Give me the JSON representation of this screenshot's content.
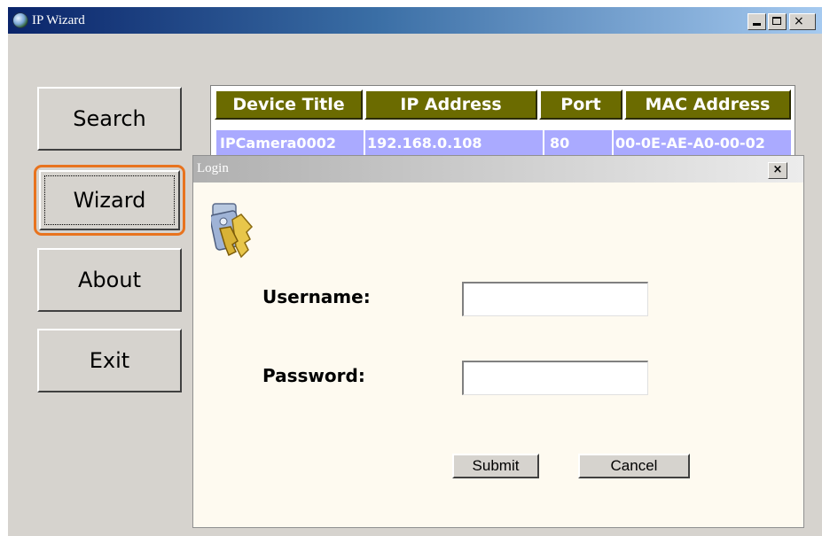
{
  "window": {
    "title": "IP Wizard",
    "icon": "globe-icon",
    "caption_buttons": {
      "minimize": "minimize-icon",
      "maximize": "maximize-icon",
      "close_label": "×"
    }
  },
  "sidebar": {
    "search_label": "Search",
    "wizard_label": "Wizard",
    "about_label": "About",
    "exit_label": "Exit",
    "highlight_color": "#e8731e"
  },
  "device_table": {
    "columns": [
      "Device Title",
      "IP Address",
      "Port",
      "MAC Address"
    ],
    "header_color": "#6b6b00",
    "row_color": "#aaaaff",
    "rows": [
      {
        "device_title": "IPCamera0002",
        "ip_address": "192.168.0.108",
        "port": "80",
        "mac_address": "00-0E-AE-A0-00-02"
      }
    ]
  },
  "login_dialog": {
    "title": "Login",
    "close_label": "×",
    "icon": "keys-icon",
    "username_label": "Username:",
    "username_value": "",
    "password_label": "Password:",
    "password_value": "",
    "submit_label": "Submit",
    "cancel_label": "Cancel"
  }
}
